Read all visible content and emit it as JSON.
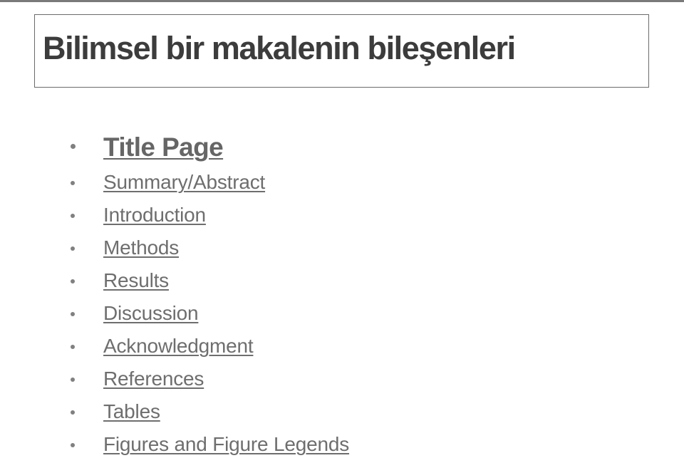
{
  "slide": {
    "title": "Bilimsel bir makalenin bileşenleri",
    "items": [
      {
        "label": "Title Page",
        "emphasis": true
      },
      {
        "label": "Summary/Abstract",
        "emphasis": false
      },
      {
        "label": "Introduction",
        "emphasis": false
      },
      {
        "label": "Methods",
        "emphasis": false
      },
      {
        "label": "Results",
        "emphasis": false
      },
      {
        "label": "Discussion",
        "emphasis": false
      },
      {
        "label": "Acknowledgment",
        "emphasis": false
      },
      {
        "label": "References",
        "emphasis": false
      },
      {
        "label": "Tables",
        "emphasis": false
      },
      {
        "label": "Figures and Figure Legends",
        "emphasis": false
      }
    ]
  },
  "colors": {
    "title_text": "#3c3c3c",
    "link_text": "#6e6e6e",
    "bullet": "#808080",
    "border": "#6b6b6b"
  }
}
